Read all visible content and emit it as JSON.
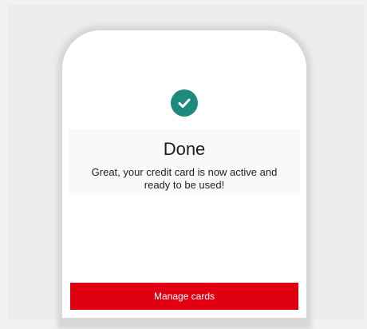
{
  "confirmation": {
    "icon": "check-circle-icon",
    "title": "Done",
    "message": "Great, your credit card is now active and ready to be used!"
  },
  "actions": {
    "manage_cards_label": "Manage cards"
  },
  "colors": {
    "accent": "#1e8a7e",
    "primary_button": "#e00012"
  }
}
